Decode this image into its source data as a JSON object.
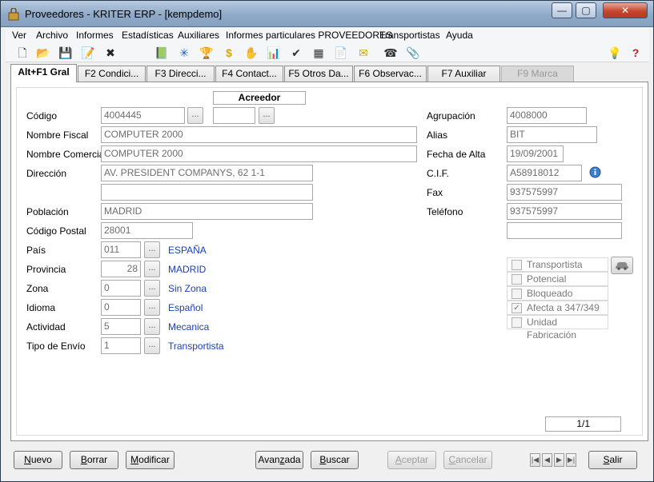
{
  "window": {
    "title": "Proveedores - KRITER ERP - [kempdemo]",
    "min_glyph": "—",
    "max_glyph": "▢",
    "close_glyph": "✕"
  },
  "menu": [
    "Ver",
    "Archivo",
    "Informes",
    "Estadísticas",
    "Auxiliares",
    "Informes particulares PROVEEDORES",
    "Transportistas",
    "Ayuda"
  ],
  "toolbar": {
    "icons": [
      "new-doc-icon",
      "open-folder-icon",
      "save-icon",
      "edit-icon",
      "delete-icon",
      "book-icon",
      "network-icon",
      "trophy-icon",
      "dollar-icon",
      "hand-icon",
      "chart-icon",
      "check-list-icon",
      "table-icon",
      "document-icon",
      "mail-icon",
      "phone-icon",
      "clip-icon",
      "lightbulb-icon",
      "help-icon"
    ],
    "glyphs": [
      "🗋",
      "📂",
      "💾",
      "📝",
      "✖",
      "📗",
      "✳",
      "🏆",
      "$",
      "✋",
      "📊",
      "✔",
      "▦",
      "📄",
      "✉",
      "☎",
      "📎",
      "💡",
      "?"
    ]
  },
  "tabs": [
    {
      "label": "Alt+F1 Gral",
      "state": "active"
    },
    {
      "label": "F2 Condici...",
      "state": "normal"
    },
    {
      "label": "F3 Direcci...",
      "state": "normal"
    },
    {
      "label": "F4 Contact...",
      "state": "normal"
    },
    {
      "label": "F5 Otros Da...",
      "state": "normal"
    },
    {
      "label": "F6 Observac...",
      "state": "normal"
    },
    {
      "label": "F7 Auxiliar",
      "state": "normal"
    },
    {
      "label": "F9 Marca",
      "state": "disabled"
    }
  ],
  "form": {
    "type_badge": "Acreedor",
    "dots": "...",
    "codigo": {
      "label": "Código",
      "value": "4004445",
      "extra": ""
    },
    "nombre_fiscal": {
      "label": "Nombre Fiscal",
      "value": "COMPUTER 2000"
    },
    "nombre_comercial": {
      "label": "Nombre Comercial",
      "value": "COMPUTER 2000"
    },
    "direccion": {
      "label": "Dirección",
      "value": "AV. PRESIDENT COMPANYS, 62 1-1",
      "value2": ""
    },
    "poblacion": {
      "label": "Población",
      "value": "MADRID"
    },
    "codigo_postal": {
      "label": "Código Postal",
      "value": "28001"
    },
    "pais": {
      "label": "País",
      "value": "011",
      "desc": "ESPAÑA"
    },
    "provincia": {
      "label": "Provincia",
      "value": "28",
      "desc": "MADRID"
    },
    "zona": {
      "label": "Zona",
      "value": "0",
      "desc": "Sin Zona"
    },
    "idioma": {
      "label": "Idioma",
      "value": "0",
      "desc": "Español"
    },
    "actividad": {
      "label": "Actividad",
      "value": "5",
      "desc": "Mecanica"
    },
    "tipo_envio": {
      "label": "Tipo de Envío",
      "value": "1",
      "desc": "Transportista"
    },
    "agrupacion": {
      "label": "Agrupación",
      "value": "4008000"
    },
    "alias": {
      "label": "Alias",
      "value": "BIT"
    },
    "fecha_alta": {
      "label": "Fecha de Alta",
      "value": "19/09/2001"
    },
    "cif": {
      "label": "C.I.F.",
      "value": "A58918012"
    },
    "fax": {
      "label": "Fax",
      "value": "937575997"
    },
    "telefono": {
      "label": "Teléfono",
      "value": "937575997",
      "value2": ""
    }
  },
  "checkboxes": [
    {
      "label": "Transportista",
      "checked": false
    },
    {
      "label": "Potencial",
      "checked": false
    },
    {
      "label": "Bloqueado",
      "checked": false
    },
    {
      "label": "Afecta a 347/349",
      "checked": true
    },
    {
      "label": "Unidad Fabricación",
      "checked": false
    }
  ],
  "pager": {
    "text": "1/1"
  },
  "buttons": {
    "nuevo": {
      "u": "N",
      "rest": "uevo"
    },
    "borrar": {
      "u": "B",
      "rest": "orrar"
    },
    "modificar": {
      "u": "M",
      "rest": "odificar"
    },
    "avanzada": {
      "pre": "Avan",
      "u": "z",
      "rest": "ada"
    },
    "buscar": {
      "u": "B",
      "rest": "uscar"
    },
    "aceptar": {
      "u": "A",
      "rest": "ceptar"
    },
    "cancelar": {
      "u": "C",
      "rest": "ancelar"
    },
    "salir": {
      "u": "S",
      "rest": "alir"
    }
  },
  "nav": {
    "first": "|◀",
    "prev": "◀",
    "next": "▶",
    "last": "▶|"
  }
}
